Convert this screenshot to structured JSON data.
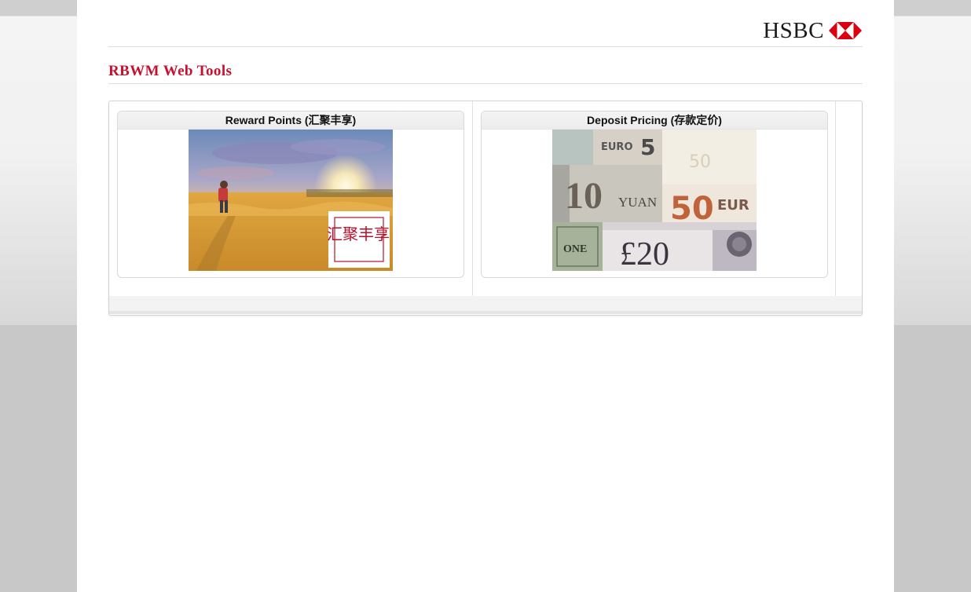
{
  "header": {
    "logo_text": "HSBC",
    "brand_color": "#db0011"
  },
  "page": {
    "title": "RBWM Web Tools",
    "title_color": "#c8102e"
  },
  "tools": [
    {
      "label": "Reward Points (汇聚丰享)",
      "image": "field-walker-sunset-image",
      "badge_text": "汇聚丰享"
    },
    {
      "label": "Deposit Pricing (存款定价)",
      "image": "currency-banknotes-image",
      "banknote_texts": [
        "EURO",
        "5",
        "50",
        "10",
        "YUAN",
        "50",
        "EUR",
        "ONE",
        "£20"
      ]
    }
  ]
}
